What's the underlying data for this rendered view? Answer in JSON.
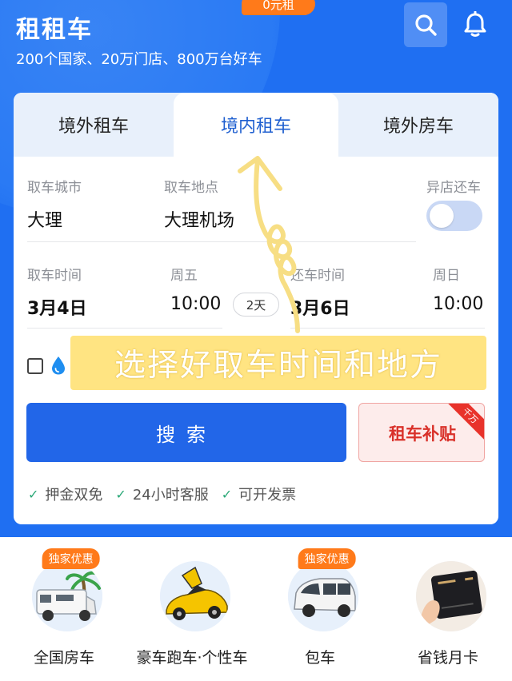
{
  "header": {
    "title": "租租车",
    "subtitle": "200个国家、20万门店、800万台好车"
  },
  "tabs": [
    {
      "label": "境外租车",
      "active": false
    },
    {
      "label": "境内租车",
      "active": true,
      "badge": "0元租"
    },
    {
      "label": "境外房车",
      "active": false
    }
  ],
  "form": {
    "pickup_city_label": "取车城市",
    "pickup_city": "大理",
    "pickup_place_label": "取车地点",
    "pickup_place": "大理机场",
    "return_diff_label": "异店还车",
    "pickup_time_label": "取车时间",
    "pickup_date": "3月4日",
    "pickup_weekday": "周五",
    "pickup_clock": "10:00",
    "duration": "2天",
    "return_time_label": "还车时间",
    "return_date": "3月6日",
    "return_weekday": "周日",
    "return_clock": "10:00"
  },
  "annotation": "选择好取车时间和地方",
  "actions": {
    "search_label": "搜索",
    "subsidy_label": "租车补贴",
    "subsidy_ribbon": "千万"
  },
  "perks": [
    "押金双免",
    "24小时客服",
    "可开发票"
  ],
  "categories": [
    {
      "label": "全国房车",
      "badge": "独家优惠"
    },
    {
      "label": "豪车跑车·个性车",
      "badge": ""
    },
    {
      "label": "包车",
      "badge": "独家优惠"
    },
    {
      "label": "省钱月卡",
      "badge": ""
    }
  ],
  "colors": {
    "brand_blue": "#1f6ff2",
    "button_blue": "#2266e8",
    "badge_orange": "#ff7a1a",
    "check_green": "#2aa877",
    "subsidy_red": "#d9312a"
  }
}
